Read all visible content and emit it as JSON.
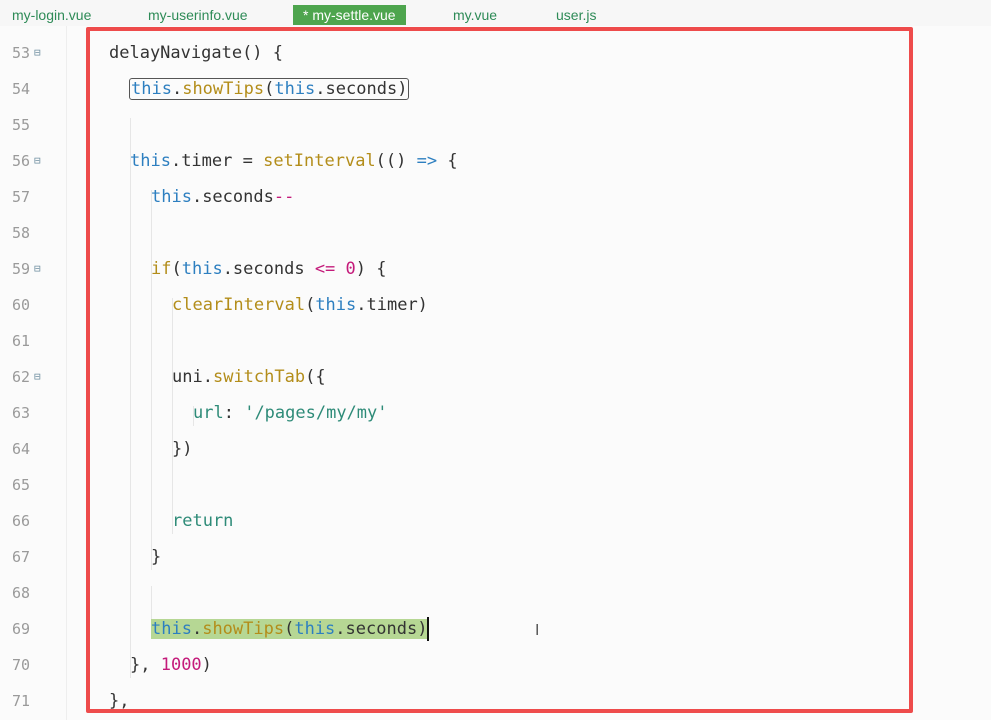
{
  "tabs": [
    {
      "label": "my-login.vue",
      "active": false
    },
    {
      "label": "my-userinfo.vue",
      "active": false
    },
    {
      "label": "* my-settle.vue",
      "active": true
    },
    {
      "label": "my.vue",
      "active": false
    },
    {
      "label": "user.js",
      "active": false
    }
  ],
  "line_numbers": [
    "53",
    "54",
    "55",
    "56",
    "57",
    "58",
    "59",
    "60",
    "61",
    "62",
    "63",
    "64",
    "65",
    "66",
    "67",
    "68",
    "69",
    "70",
    "71"
  ],
  "fold_marker": "⊟",
  "code": {
    "l53": {
      "name": "delayNavigate",
      "rest": "() {"
    },
    "l54": {
      "this": "this",
      "dot": ".",
      "fn": "showTips",
      "open": "(",
      "this2": "this",
      "dot2": ".",
      "arg": "seconds",
      "close": ")"
    },
    "l56": {
      "this": "this",
      "prop": ".timer = ",
      "fn": "setInterval",
      "open": "(() ",
      "arrow": "=>",
      "rest": " {"
    },
    "l57": {
      "this": "this",
      "prop": ".seconds",
      "op": "--"
    },
    "l59": {
      "kw": "if",
      "open": "(",
      "this": "this",
      "prop": ".seconds ",
      "op": "<=",
      "num": " 0",
      "rest": ") {"
    },
    "l60": {
      "fn": "clearInterval",
      "open": "(",
      "this": "this",
      "rest": ".timer)"
    },
    "l62": {
      "obj": "uni",
      "dot": ".",
      "fn": "switchTab",
      "rest": "({"
    },
    "l63": {
      "key": "url",
      "colon": ": ",
      "str": "'/pages/my/my'"
    },
    "l64": {
      "text": "})"
    },
    "l66": {
      "kw": "return"
    },
    "l67": {
      "text": "}"
    },
    "l69": {
      "this": "this",
      "dot": ".",
      "fn": "showTips",
      "open": "(",
      "this2": "this",
      "dot2": ".",
      "arg": "seconds",
      "close": ")"
    },
    "l70": {
      "pre": "}, ",
      "num": "1000",
      "close": ")"
    },
    "l71": {
      "text": "},"
    }
  },
  "colors": {
    "accent_tab": "#4ea54e",
    "highlight_box": "#ee4b4b",
    "selection": "#b6d794"
  },
  "cursor_icon": "text-cursor-icon"
}
